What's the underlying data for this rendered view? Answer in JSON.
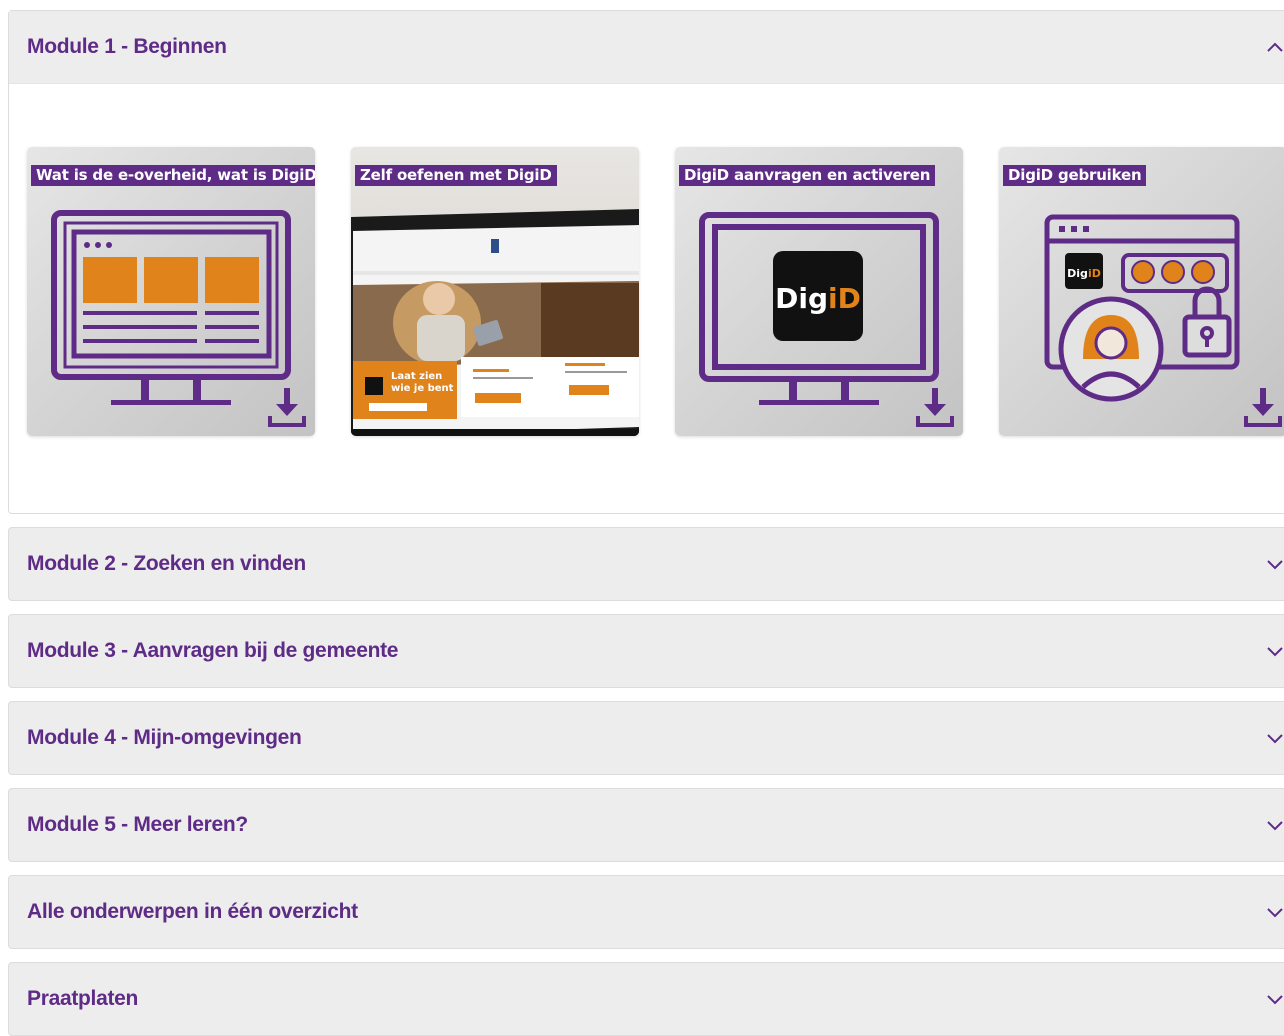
{
  "modules": [
    {
      "title": "Module 1 - Beginnen",
      "expanded": true
    },
    {
      "title": "Module 2 - Zoeken en vinden",
      "expanded": false
    },
    {
      "title": "Module 3 - Aanvragen bij de gemeente",
      "expanded": false
    },
    {
      "title": "Module 4 - Mijn-omgevingen",
      "expanded": false
    },
    {
      "title": "Module 5 - Meer leren?",
      "expanded": false
    },
    {
      "title": "Alle onderwerpen in één overzicht",
      "expanded": false
    },
    {
      "title": "Praatplaten",
      "expanded": false
    }
  ],
  "tiles": [
    {
      "label": "Wat is de e-overheid, wat is DigiD?",
      "icon": "monitor-webpage-icon"
    },
    {
      "label": "Zelf oefenen met DigiD",
      "photo": {
        "banner_line1": "Laat zien",
        "banner_line2": "wie je bent"
      }
    },
    {
      "label": "DigiD aanvragen en activeren",
      "icon": "monitor-digid-icon",
      "logo_text_a": "Dig",
      "logo_text_b": "iD"
    },
    {
      "label": "DigiD gebruiken",
      "icon": "digid-login-icon",
      "logo_text_a": "Dig",
      "logo_text_b": "iD"
    }
  ],
  "colors": {
    "brand_purple": "#5e2b86",
    "accent_orange": "#e0831b",
    "header_bg": "#ededed"
  }
}
